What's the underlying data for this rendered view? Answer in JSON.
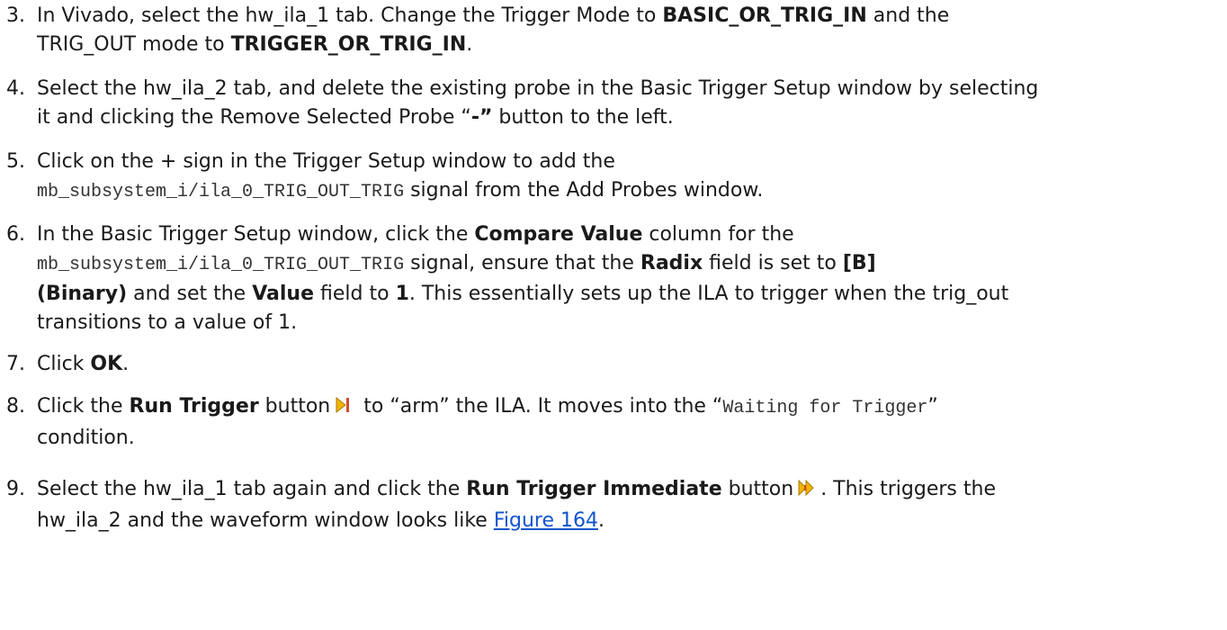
{
  "steps": [
    {
      "num": "3.",
      "l1a": "In Vivado, select the hw_ila_1 tab. Change the Trigger Mode to ",
      "l1b": "BASIC_OR_TRIG_IN",
      "l1c": " and the",
      "l2a": "TRIG_OUT mode to ",
      "l2b": "TRIGGER_OR_TRIG_IN",
      "l2c": "."
    },
    {
      "num": "4.",
      "l1": "Select the hw_ila_2 tab, and delete the existing probe in the Basic Trigger Setup window by selecting",
      "l2a": "it and clicking the Remove Selected Probe “",
      "l2b": "-”",
      "l2c": " button to the left."
    },
    {
      "num": "5.",
      "l1": "Click on the + sign in the Trigger Setup window to add the",
      "l2a": "mb_subsystem_i/ila_0_TRIG_OUT_TRIG",
      "l2b": " signal from the Add Probes window."
    },
    {
      "num": "6.",
      "l1a": "In the Basic Trigger Setup window, click the ",
      "l1b": "Compare Value",
      "l1c": " column for the",
      "l2a": "mb_subsystem_i/ila_0_TRIG_OUT_TRIG",
      "l2b": " signal, ensure that the ",
      "l2c": "Radix",
      "l2d": " field is set to ",
      "l2e": "[B]",
      "l3a": "(Binary)",
      "l3b": " and set the ",
      "l3c": "Value",
      "l3d": " field to ",
      "l3e": "1",
      "l3f": ". This essentially sets up the ILA to trigger when the trig_out",
      "l4": "transitions to a value of 1."
    },
    {
      "num": "7.",
      "l1a": "Click ",
      "l1b": "OK",
      "l1c": "."
    },
    {
      "num": "8.",
      "l1a": "Click the ",
      "l1b": "Run Trigger",
      "l1c": " button",
      "l1d": " to “arm” the ILA. It moves into the “",
      "l1e": "Waiting for Trigger",
      "l1f": "”",
      "l2": "condition."
    },
    {
      "num": "9.",
      "l1a": "Select the hw_ila_1 tab again and click the ",
      "l1b": "Run Trigger Immediate",
      "l1c": " button",
      "l1d": ". This triggers the",
      "l2a": "hw_ila_2 and the waveform window looks like ",
      "l2b": "Figure 164",
      "l2c": "."
    }
  ],
  "icons": {
    "run_trigger": "run-trigger-icon",
    "run_trigger_immediate": "run-trigger-immediate-icon",
    "icon_color": "#f0b400"
  }
}
